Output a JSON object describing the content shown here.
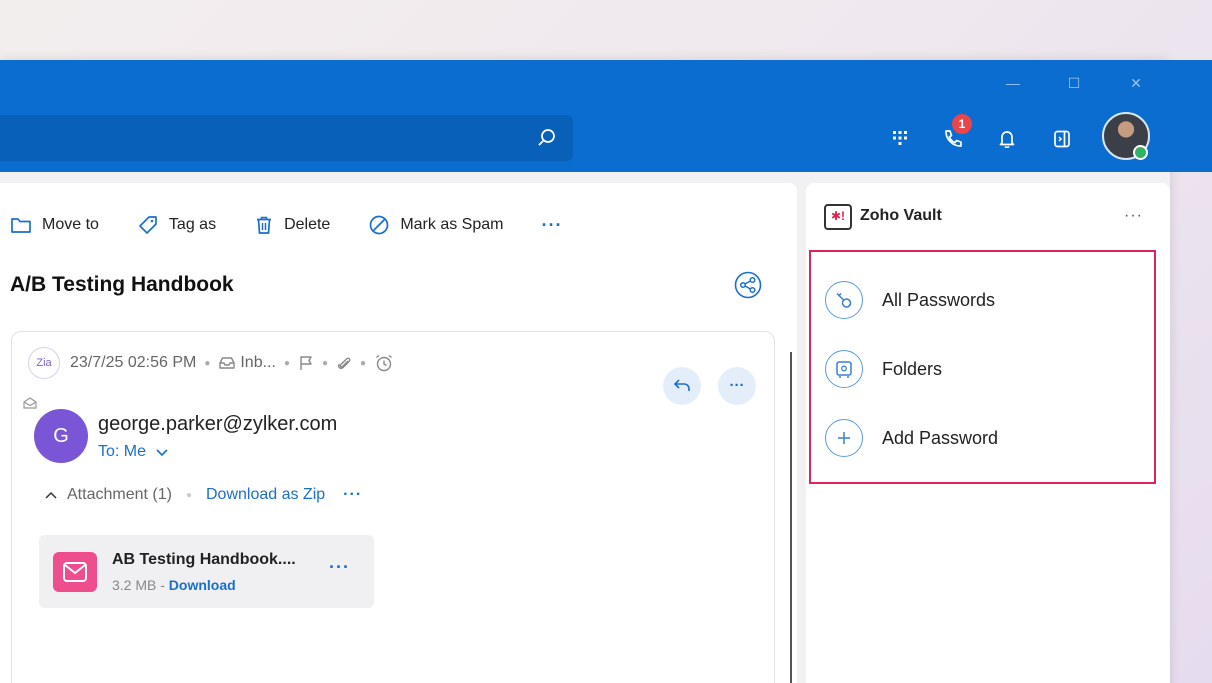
{
  "window": {
    "minimize": "—",
    "maximize": "☐",
    "close": "✕"
  },
  "header": {
    "call_badge": "1"
  },
  "toolbar": {
    "move_to": "Move to",
    "tag_as": "Tag as",
    "delete": "Delete",
    "mark_spam": "Mark as Spam",
    "more": "···"
  },
  "mail": {
    "title": "A/B Testing Handbook",
    "zia": "Zia",
    "date": "23/7/25 02:56 PM",
    "folder": "Inb...",
    "sender_initial": "G",
    "sender": "george.parker@zylker.com",
    "to": "To: Me",
    "attachment_label": "Attachment (1)",
    "download_zip": "Download as Zip",
    "more": "···",
    "file": {
      "name": "AB Testing Handbook....",
      "size": "3.2 MB - ",
      "download": "Download",
      "more": "···"
    }
  },
  "vault": {
    "title": "Zoho Vault",
    "more": "···",
    "items": [
      {
        "label": "All Passwords"
      },
      {
        "label": "Folders"
      },
      {
        "label": "Add Password"
      }
    ]
  },
  "colors": {
    "accent": "#0b6dcf",
    "highlight": "#e0235d",
    "badge": "#e8464b"
  }
}
